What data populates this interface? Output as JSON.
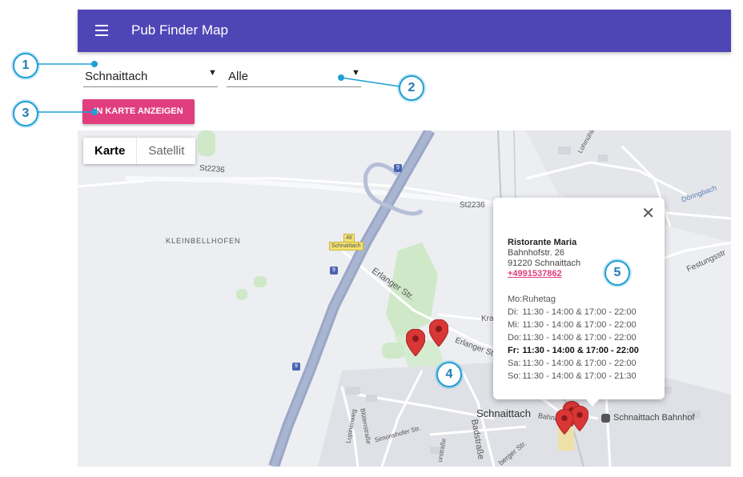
{
  "appbar": {
    "title": "Pub Finder Map"
  },
  "filters": {
    "location_value": "Schnaittach",
    "category_value": "Alle"
  },
  "actions": {
    "show_on_map": "IN KARTE ANZEIGEN"
  },
  "map": {
    "type_controls": [
      "Karte",
      "Satellit"
    ],
    "labels": {
      "st2236_a": "St2236",
      "st2236_b": "St2236",
      "kleinbellhofen": "KLEINBELLHOFEN",
      "schnaittach_exit": "Schnaittach",
      "exit_no": "48",
      "a9_a": "9",
      "a9_b": "9",
      "a9_c": "9",
      "erlanger_str_a": "Erlanger Str.",
      "erlanger_str_b": "Erlanger Str.",
      "kra": "Kra",
      "lohmuhle": "Lohmühle",
      "doringbach": "Döringbach",
      "festungsstr": "Festungsstr",
      "town": "Schnaittach",
      "bahnhof": "Schnaittach Bahnhof",
      "bahnh": "Bahnh",
      "badstrasse": "Badstraße",
      "lupinenweg": "Lupinenweg",
      "blutenstrasse": "Blütenstraße",
      "simonshofer": "Simonshofer Str.",
      "burstrasse": "urstraße",
      "berger": "berger Str."
    }
  },
  "info_window": {
    "name": "Ristorante Maria",
    "street": "Bahnhofstr. 26",
    "city": "91220 Schnaittach",
    "phone": "+4991537862",
    "close_icon": "close-icon",
    "hours": [
      {
        "day": "Mo:",
        "time": "Ruhetag",
        "today": false
      },
      {
        "day": "Di:",
        "time": "11:30 - 14:00 & 17:00 - 22:00",
        "today": false
      },
      {
        "day": "Mi:",
        "time": "11:30 - 14:00 & 17:00 - 22:00",
        "today": false
      },
      {
        "day": "Do:",
        "time": "11:30 - 14:00 & 17:00 - 22:00",
        "today": false
      },
      {
        "day": "Fr:",
        "time": "11:30 - 14:00 & 17:00 - 22:00",
        "today": true
      },
      {
        "day": "Sa:",
        "time": "11:30 - 14:00 & 17:00 - 22:00",
        "today": false
      },
      {
        "day": "So:",
        "time": "11:30 - 14:00 & 17:00 - 21:30",
        "today": false
      }
    ]
  },
  "callouts": [
    "1",
    "2",
    "3",
    "4",
    "5"
  ],
  "colors": {
    "appbar": "#4f46b6",
    "button": "#e03e7f",
    "callout": "#1f9fd6",
    "pin": "#d93636"
  }
}
